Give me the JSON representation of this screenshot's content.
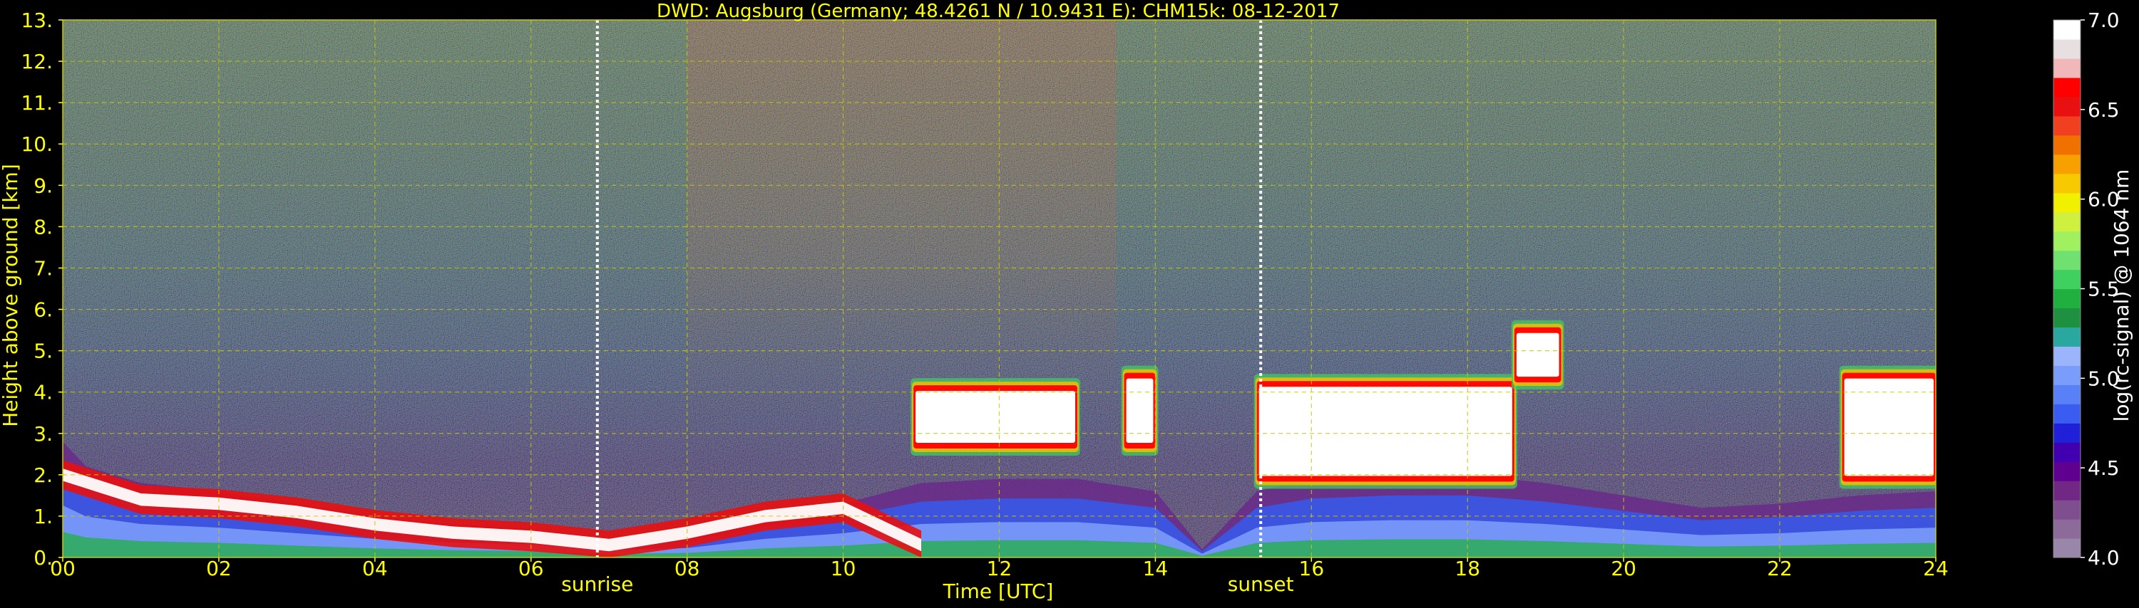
{
  "chart_data": {
    "type": "heatmap",
    "title": "DWD: Augsburg (Germany; 48.4261 N / 10.9431 E):    CHM15k: 08-12-2017",
    "xlabel": "Time [UTC]",
    "ylabel": "Height above ground [km]",
    "xlim": [
      0,
      24
    ],
    "ylim": [
      0,
      13
    ],
    "xticks": [
      0,
      2,
      4,
      6,
      8,
      10,
      12,
      14,
      16,
      18,
      20,
      22,
      24
    ],
    "xtick_labels": [
      "00",
      "02",
      "04",
      "06",
      "08",
      "10",
      "12",
      "14",
      "16",
      "18",
      "20",
      "22",
      "24"
    ],
    "yticks": [
      0,
      1,
      2,
      3,
      4,
      5,
      6,
      7,
      8,
      9,
      10,
      11,
      12,
      13
    ],
    "ytick_labels": [
      "0.",
      "1.",
      "2.",
      "3.",
      "4.",
      "5.",
      "6.",
      "7.",
      "8.",
      "9.",
      "10.",
      "11.",
      "12.",
      "13."
    ],
    "grid": true,
    "markers": [
      {
        "label": "sunrise",
        "x": 6.85
      },
      {
        "label": "sunset",
        "x": 15.35
      }
    ],
    "colorbar": {
      "label": "log(rc-signal) @ 1064 nm",
      "range": [
        4.0,
        7.0
      ],
      "ticks": [
        4.0,
        4.5,
        5.0,
        5.5,
        6.0,
        6.5,
        7.0
      ],
      "tick_labels": [
        "4.0",
        "4.5",
        "5.0",
        "5.5",
        "6.0",
        "6.5",
        "7.0"
      ],
      "colors": [
        "#9a86a8",
        "#8c6a9a",
        "#7e4e8e",
        "#702884",
        "#600090",
        "#4000b0",
        "#2020d8",
        "#3a5cf0",
        "#5a80f8",
        "#7a9cfa",
        "#9cb4fc",
        "#2aa8a0",
        "#1e9040",
        "#20b040",
        "#40d060",
        "#70e070",
        "#a0f060",
        "#d0f040",
        "#f0f000",
        "#f8c800",
        "#f8a000",
        "#f07000",
        "#f04020",
        "#e81010",
        "#ff0000",
        "#f0b8b8",
        "#e8e0e0",
        "#ffffff"
      ]
    },
    "colors": {
      "title": "#ffff00",
      "axes_text": "#ffff00",
      "grid": "#c8c800",
      "colorbar_text": "#ffffff",
      "marker_line": "#ffffff"
    },
    "features": {
      "cloud_layers": [
        {
          "x": [
            10.9,
            13.0
          ],
          "base_km": 2.6,
          "top_km": 4.2
        },
        {
          "x": [
            13.6,
            14.0
          ],
          "base_km": 2.6,
          "top_km": 4.5
        },
        {
          "x": [
            15.3,
            18.6
          ],
          "base_km": 1.8,
          "top_km": 4.3
        },
        {
          "x": [
            18.6,
            19.2
          ],
          "base_km": 4.2,
          "top_km": 5.6
        },
        {
          "x": [
            22.8,
            24.0
          ],
          "base_km": 1.8,
          "top_km": 4.5
        }
      ],
      "boundary_layer_top_km": [
        [
          0.0,
          2.8
        ],
        [
          0.3,
          2.2
        ],
        [
          1.0,
          1.8
        ],
        [
          2.0,
          1.6
        ],
        [
          3.0,
          1.3
        ],
        [
          4.0,
          1.0
        ],
        [
          5.0,
          0.8
        ],
        [
          6.0,
          0.7
        ],
        [
          7.0,
          0.4
        ],
        [
          8.0,
          0.5
        ],
        [
          9.0,
          1.0
        ],
        [
          10.0,
          1.3
        ],
        [
          11.0,
          1.8
        ],
        [
          12.0,
          1.9
        ],
        [
          13.0,
          1.9
        ],
        [
          14.0,
          1.6
        ],
        [
          14.6,
          0.2
        ],
        [
          15.3,
          1.6
        ],
        [
          16.0,
          1.9
        ],
        [
          17.0,
          2.0
        ],
        [
          18.0,
          2.0
        ],
        [
          19.0,
          1.8
        ],
        [
          20.0,
          1.5
        ],
        [
          21.0,
          1.2
        ],
        [
          22.0,
          1.3
        ],
        [
          23.0,
          1.5
        ],
        [
          24.0,
          1.6
        ]
      ]
    }
  }
}
